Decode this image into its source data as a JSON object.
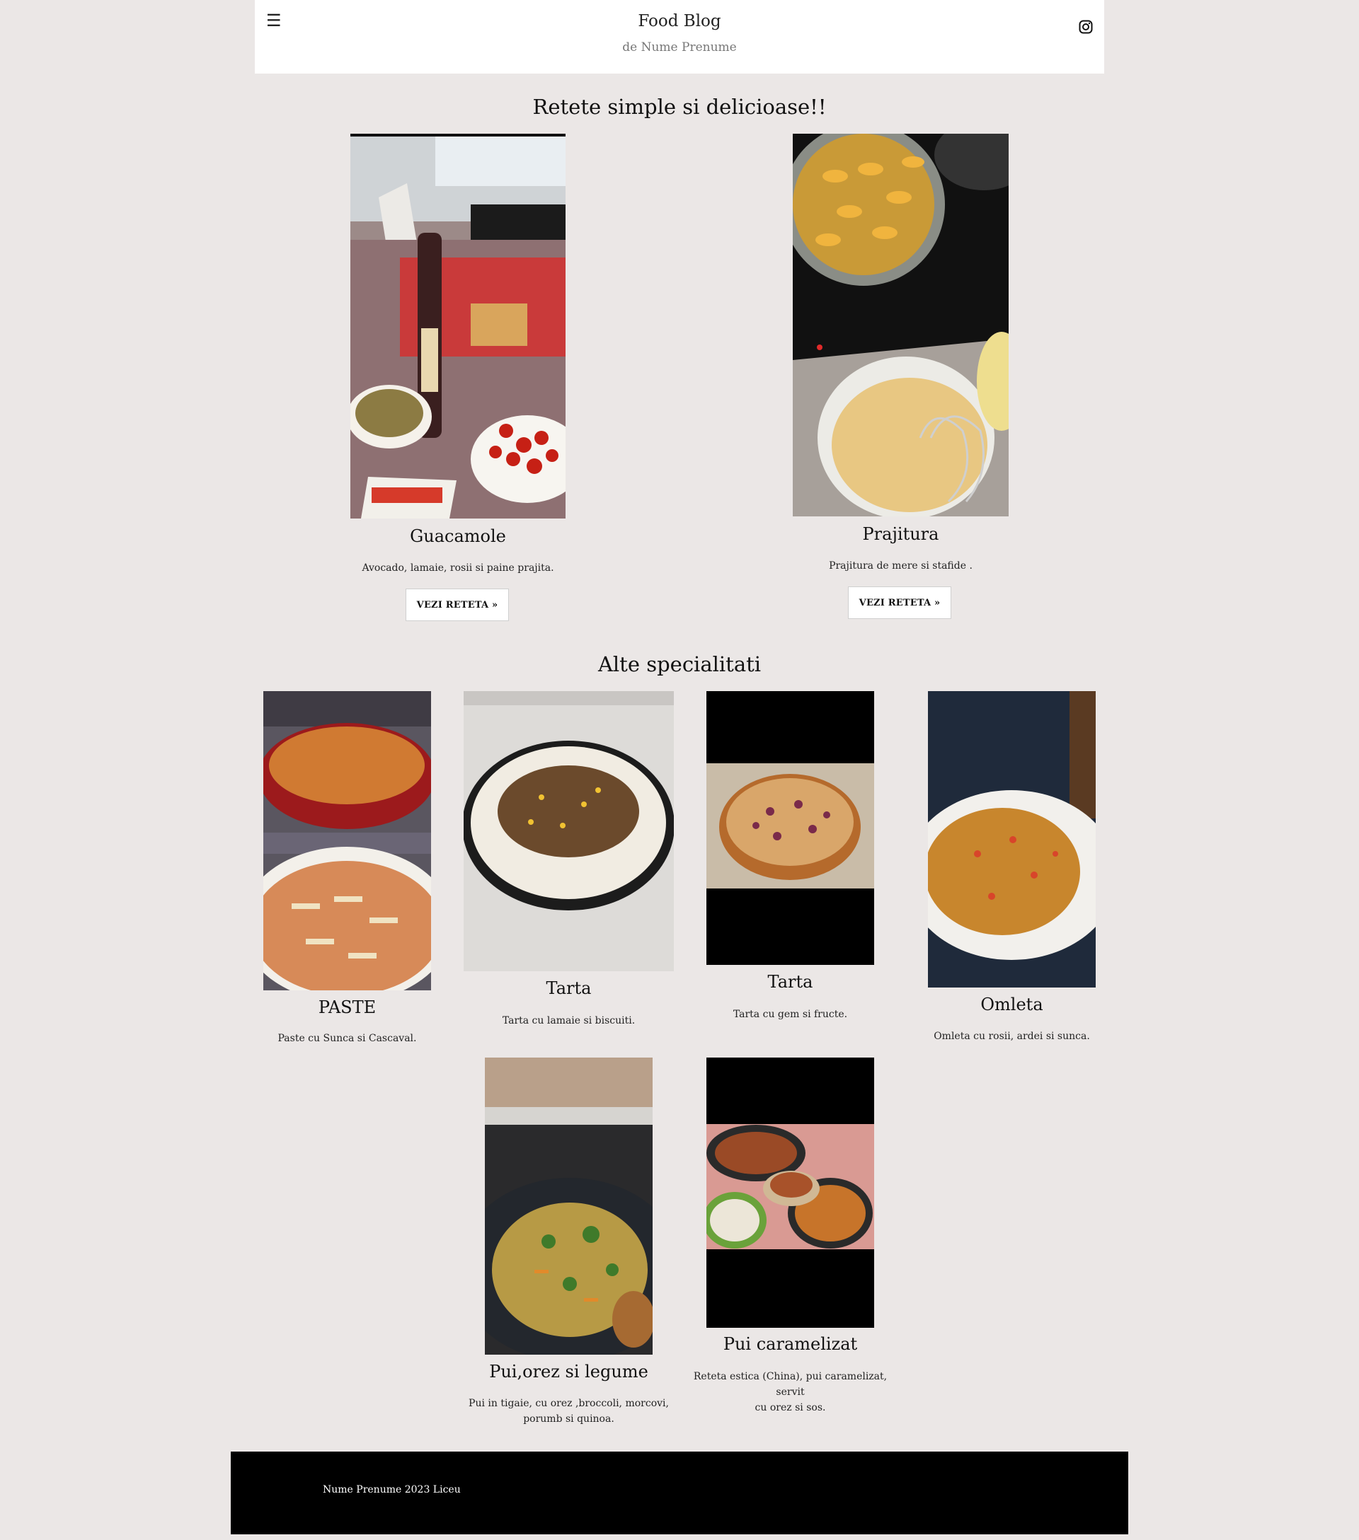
{
  "header": {
    "menu_icon": "hamburger-icon",
    "title": "Food Blog",
    "subtitle": "de Nume Prenume",
    "social_icon": "instagram-icon"
  },
  "featured": {
    "heading": "Retete simple si delicioase!!",
    "items": [
      {
        "title": "Guacamole",
        "description": "Avocado, lamaie, rosii si paine prajita.",
        "button": "VEZI RETETA »"
      },
      {
        "title": "Prajitura",
        "description": "Prajitura de mere si stafide .",
        "button": "VEZI RETETA »"
      }
    ]
  },
  "others": {
    "heading": "Alte specialitati",
    "items": [
      {
        "title": "PASTE",
        "description": "Paste cu Sunca si Cascaval."
      },
      {
        "title": "Tarta",
        "description": "Tarta cu lamaie si biscuiti."
      },
      {
        "title": "Tarta",
        "description": "Tarta cu gem si fructe."
      },
      {
        "title": "Omleta",
        "description": "Omleta cu rosii, ardei si sunca."
      },
      {
        "title": "Pui,orez si legume",
        "description_line1": "Pui in tigaie, cu orez ,broccoli, morcovi,",
        "description_line2": "porumb si quinoa."
      },
      {
        "title": "Pui caramelizat",
        "description_line1": "Reteta estica (China), pui caramelizat, servit",
        "description_line2": "cu orez si sos."
      }
    ]
  },
  "footer": {
    "text": "Nume Prenume 2023 Liceu"
  }
}
